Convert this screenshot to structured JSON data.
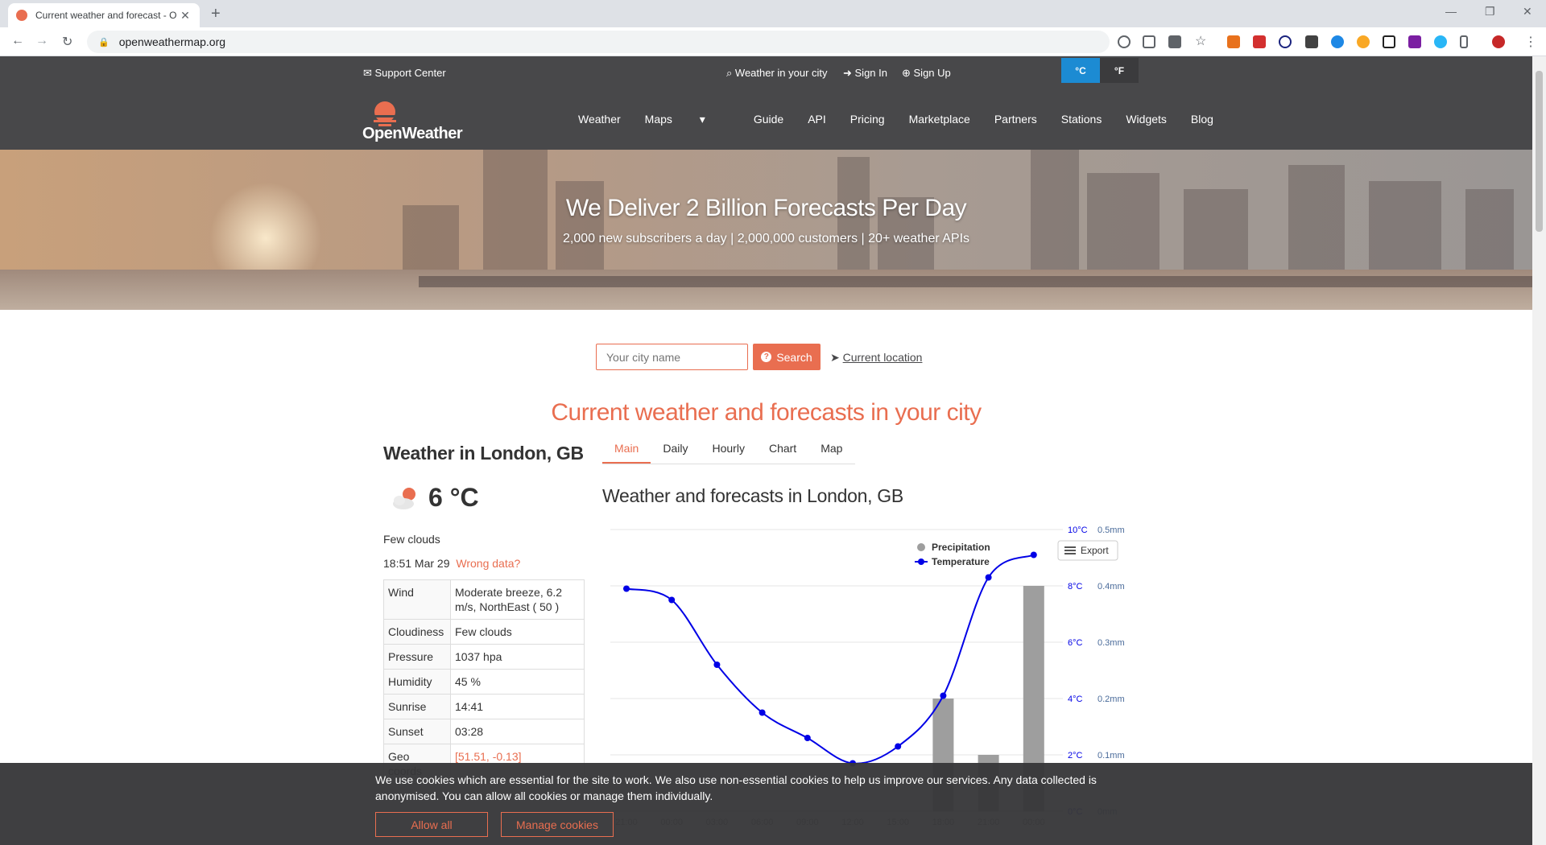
{
  "browser": {
    "tab_title": "Current weather and forecast - O",
    "url": "openweathermap.org"
  },
  "topbar": {
    "support": "Support Center",
    "weather_city": "Weather in your city",
    "sign_in": "Sign In",
    "sign_up": "Sign Up",
    "unit_c": "°C",
    "unit_f": "°F"
  },
  "nav": {
    "logo": "OpenWeather",
    "items": [
      "Weather",
      "Maps",
      "Guide",
      "API",
      "Pricing",
      "Marketplace",
      "Partners",
      "Stations",
      "Widgets",
      "Blog"
    ]
  },
  "hero": {
    "title": "We Deliver 2 Billion Forecasts Per Day",
    "subtitle": "2,000 new subscribers a day | 2,000,000 customers | 20+ weather APIs"
  },
  "search": {
    "placeholder": "Your city name",
    "button": "Search",
    "current_location": "Current location"
  },
  "section_title": "Current weather and forecasts in your city",
  "current": {
    "city": "Weather in London, GB",
    "temp": "6 °C",
    "description": "Few clouds",
    "time": "18:51 Mar 29",
    "wrong_data": "Wrong data?",
    "table": [
      {
        "k": "Wind",
        "v": "Moderate breeze, 6.2 m/s, NorthEast ( 50 )"
      },
      {
        "k": "Cloudiness",
        "v": "Few clouds"
      },
      {
        "k": "Pressure",
        "v": "1037 hpa"
      },
      {
        "k": "Humidity",
        "v": "45 %"
      },
      {
        "k": "Sunrise",
        "v": "14:41"
      },
      {
        "k": "Sunset",
        "v": "03:28"
      },
      {
        "k": "Geo coords",
        "v": "[51.51, -0.13]"
      }
    ]
  },
  "tabs": [
    "Main",
    "Daily",
    "Hourly",
    "Chart",
    "Map"
  ],
  "forecast_title": "Weather and forecasts in London, GB",
  "chart_data": {
    "type": "line",
    "x": [
      "21:00",
      "00:00",
      "03:00",
      "06:00",
      "09:00",
      "12:00",
      "15:00",
      "18:00",
      "21:00",
      "00:00"
    ],
    "series": [
      {
        "name": "Temperature",
        "type": "line",
        "unit": "°C",
        "values": [
          7.9,
          7.5,
          5.2,
          3.5,
          2.6,
          1.7,
          2.3,
          4.1,
          8.3,
          9.1
        ]
      },
      {
        "name": "Precipitation",
        "type": "bar",
        "unit": "mm",
        "values": [
          0,
          0,
          0,
          0,
          0,
          0,
          0,
          0.2,
          0.1,
          0.4
        ]
      }
    ],
    "y_left_ticks": [
      "10°C",
      "8°C",
      "6°C",
      "4°C",
      "2°C",
      "0°C"
    ],
    "y_right_ticks": [
      "0.5mm",
      "0.4mm",
      "0.3mm",
      "0.2mm",
      "0.1mm",
      "0mm"
    ],
    "ylim_temp": [
      0,
      10
    ],
    "ylim_precip": [
      0,
      0.5
    ],
    "legend": "top-right",
    "export_label": "Export",
    "colors": {
      "temperature": "#0000e6",
      "precipitation": "#9e9e9e"
    }
  },
  "cookie": {
    "message": "We use cookies which are essential for the site to work. We also use non-essential cookies to help us improve our services. Any data collected is anonymised. You can allow all cookies or manage them individually.",
    "allow_all": "Allow all",
    "manage": "Manage cookies"
  },
  "colors": {
    "accent": "#e96e50",
    "header": "#48484a",
    "unit_active": "#1c8bd3"
  }
}
